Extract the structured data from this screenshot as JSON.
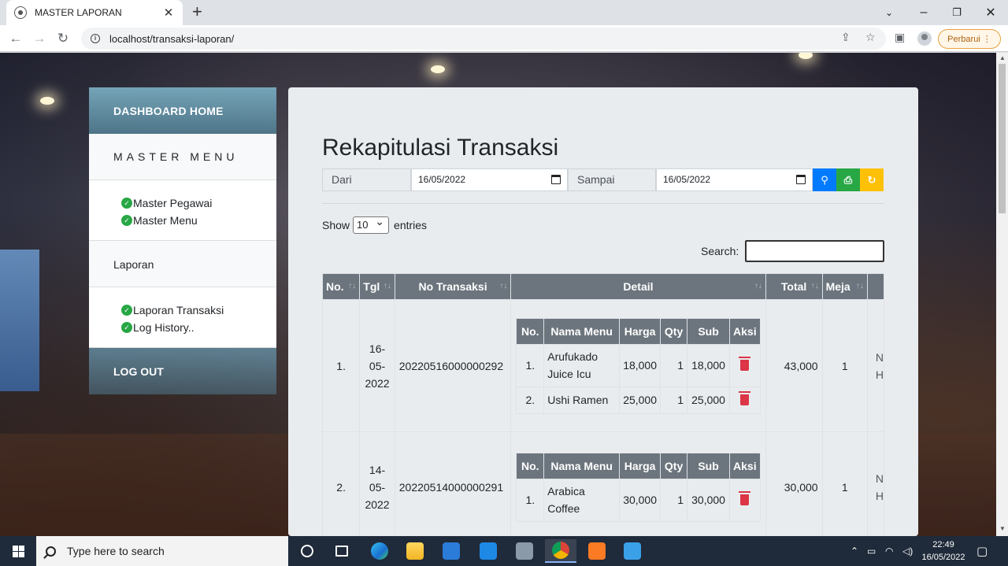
{
  "browser": {
    "tab_title": "MASTER LAPORAN",
    "url": "localhost/transaksi-laporan/",
    "update_label": "Perbarui"
  },
  "sidebar": {
    "dashboard": "DASHBOARD HOME",
    "master_heading": "MASTER MENU",
    "master_items": [
      {
        "label": "Master Pegawai"
      },
      {
        "label": "Master Menu"
      }
    ],
    "laporan_heading": "Laporan",
    "laporan_items": [
      {
        "label": "Laporan Transaksi"
      },
      {
        "label": "Log History.."
      }
    ],
    "logout": "LOG OUT"
  },
  "main": {
    "title": "Rekapitulasi Transaksi",
    "filter": {
      "from_label": "Dari",
      "from_value": "16/05/2022",
      "to_label": "Sampai",
      "to_value": "16/05/2022"
    },
    "show_prefix": "Show",
    "show_value": "10",
    "show_suffix": "entries",
    "search_label": "Search:",
    "columns": [
      "No.",
      "Tgl",
      "No Transaksi",
      "Detail",
      "Total",
      "Meja"
    ],
    "inner_columns": [
      "No.",
      "Nama Menu",
      "Harga",
      "Qty",
      "Sub",
      "Aksi"
    ],
    "rows": [
      {
        "no": "1.",
        "tgl": "16-\n05-\n2022",
        "no_transaksi": "20220516000000292",
        "items": [
          {
            "no": "1.",
            "nama": "Arufukado Juice Icu",
            "harga": "18,000",
            "qty": "1",
            "sub": "18,000"
          },
          {
            "no": "2.",
            "nama": "Ushi Ramen",
            "harga": "25,000",
            "qty": "1",
            "sub": "25,000"
          }
        ],
        "total": "43,000",
        "meja": "1"
      },
      {
        "no": "2.",
        "tgl": "14-\n05-\n2022",
        "no_transaksi": "20220514000000291",
        "items": [
          {
            "no": "1.",
            "nama": "Arabica Coffee",
            "harga": "30,000",
            "qty": "1",
            "sub": "30,000"
          }
        ],
        "total": "30,000",
        "meja": "1"
      }
    ]
  },
  "taskbar": {
    "search_placeholder": "Type here to search",
    "time": "22:49",
    "date": "16/05/2022"
  },
  "colors": {
    "primary": "#007bff",
    "success": "#28a745",
    "warning": "#ffc107",
    "danger": "#dc3545",
    "header_gray": "#6c757d"
  }
}
